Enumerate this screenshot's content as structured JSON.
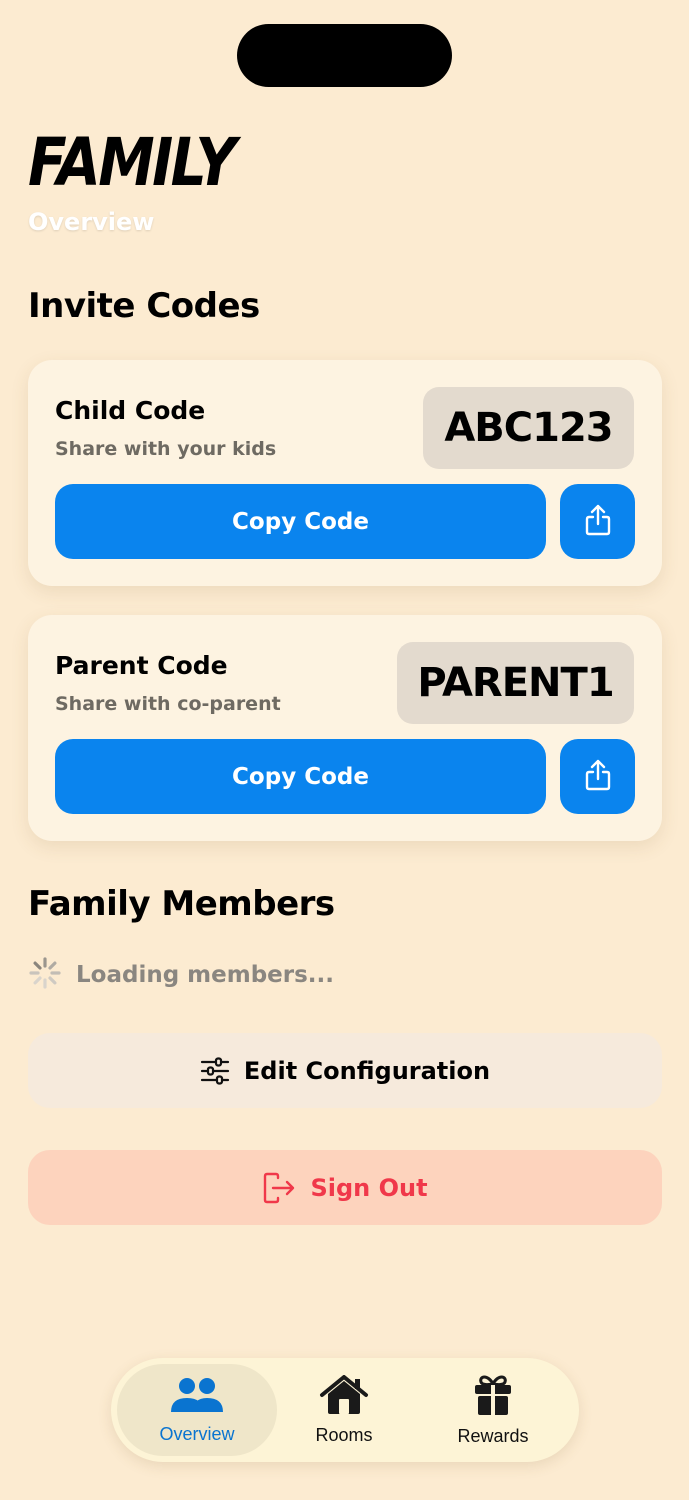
{
  "header": {
    "title": "FAMILY",
    "subtitle": "Overview"
  },
  "invite_section": {
    "heading": "Invite Codes",
    "cards": [
      {
        "title": "Child Code",
        "subtitle": "Share with your kids",
        "code": "ABC123",
        "copy_label": "Copy Code",
        "share_icon": "share-icon"
      },
      {
        "title": "Parent Code",
        "subtitle": "Share with co-parent",
        "code": "PARENT1",
        "copy_label": "Copy Code",
        "share_icon": "share-icon"
      }
    ]
  },
  "members_section": {
    "heading": "Family Members",
    "loading_text": "Loading members..."
  },
  "actions": {
    "edit_label": "Edit Configuration",
    "edit_icon": "sliders-icon",
    "signout_label": "Sign Out",
    "signout_icon": "sign-out-icon"
  },
  "tabbar": {
    "tabs": [
      {
        "label": "Overview",
        "icon": "people-icon",
        "active": true
      },
      {
        "label": "Rooms",
        "icon": "house-icon",
        "active": false
      },
      {
        "label": "Rewards",
        "icon": "gift-icon",
        "active": false
      }
    ]
  },
  "colors": {
    "background": "#fcebd1",
    "accent": "#0a84ee",
    "danger": "#f0384a",
    "card": "#fdf3e1"
  }
}
